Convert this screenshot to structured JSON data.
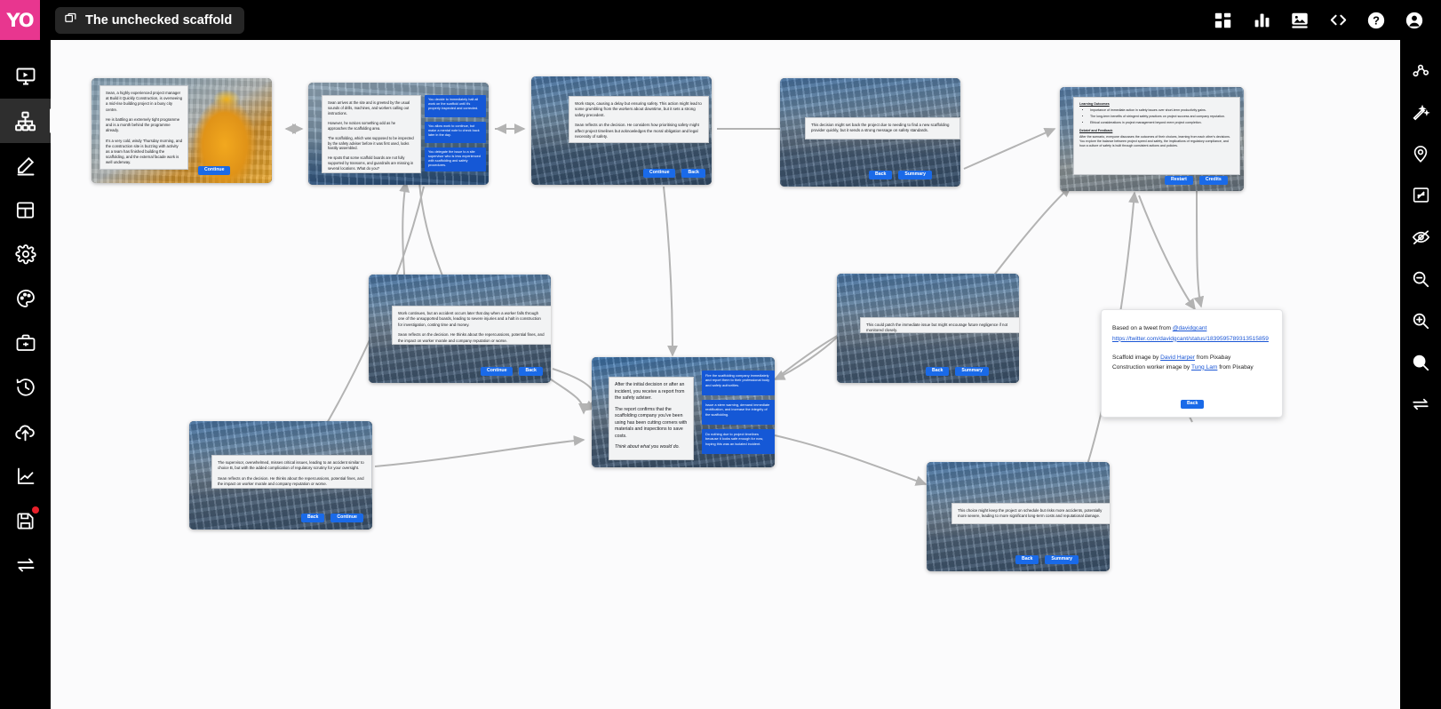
{
  "app": {
    "logo_text": "YO",
    "title": "The unchecked scaffold",
    "title_icon": "copy-windows-icon"
  },
  "topbar": {
    "icons": [
      {
        "name": "dashboard-grid-icon",
        "label": "Dashboard"
      },
      {
        "name": "analytics-bar-chart-icon",
        "label": "Analytics"
      },
      {
        "name": "media-image-icon",
        "label": "Media"
      },
      {
        "name": "code-brackets-icon",
        "label": "Code"
      },
      {
        "name": "help-question-icon",
        "label": "Help"
      },
      {
        "name": "user-account-icon",
        "label": "Account"
      }
    ]
  },
  "left_rail": {
    "items": [
      {
        "name": "preview-play-icon",
        "label": "Preview",
        "active": false
      },
      {
        "name": "flow-tree-icon",
        "label": "Flow",
        "active": true
      },
      {
        "name": "pencil-edit-icon",
        "label": "Edit",
        "active": false
      },
      {
        "name": "layout-template-icon",
        "label": "Layout",
        "active": false
      },
      {
        "name": "settings-gear-icon",
        "label": "Settings",
        "active": false
      },
      {
        "name": "theme-palette-icon",
        "label": "Theme",
        "active": false
      },
      {
        "name": "toolbox-icon",
        "label": "Tools",
        "active": false
      },
      {
        "name": "history-clock-icon",
        "label": "History",
        "active": false
      },
      {
        "name": "cloud-upload-icon",
        "label": "Publish",
        "active": false
      },
      {
        "name": "analytics-line-chart-icon",
        "label": "Stats",
        "active": false
      },
      {
        "name": "save-floppy-icon",
        "label": "Save",
        "active": false,
        "badge": true
      },
      {
        "name": "swap-arrows-icon",
        "label": "Swap",
        "active": false
      }
    ]
  },
  "right_rail": {
    "items": [
      {
        "name": "node-graph-icon",
        "label": "Graph"
      },
      {
        "name": "magic-wand-icon",
        "label": "Auto layout"
      },
      {
        "name": "map-pin-icon",
        "label": "Pin"
      },
      {
        "name": "fit-screen-icon",
        "label": "Fit to screen"
      },
      {
        "name": "eye-hidden-icon",
        "label": "Hide"
      },
      {
        "name": "zoom-out-icon",
        "label": "Zoom out"
      },
      {
        "name": "zoom-in-icon",
        "label": "Zoom in"
      },
      {
        "name": "zoom-reset-icon",
        "label": "Reset zoom"
      },
      {
        "name": "swap-arrows-icon",
        "label": "Swap"
      }
    ]
  },
  "colors": {
    "brand_pink": "#E8368F",
    "choice_blue": "#1558d6",
    "button_blue": "#1a6ae8",
    "canvas_bg": "#fbfbfc",
    "rail_bg": "#000000",
    "badge_red": "#e8202a"
  },
  "nodes": [
    {
      "id": "intro",
      "paragraphs": [
        "Sean, a highly experienced project manager at Build it Quickly Construction, is overseeing a mid-rise building project in a busy city centre.",
        "He is battling an extremely tight programme and is a month behind the programme already.",
        "It's a very cold, windy Thursday morning, and the construction site is buzzing with activity as a team has finished building the scaffolding, and the external facade work is well underway."
      ],
      "buttons": [
        "Continue"
      ]
    },
    {
      "id": "arrival",
      "paragraphs": [
        "Sean arrives at the site and is greeted by the usual sounds of drills, machines, and workers calling out instructions.",
        "However, he notices something odd as he approaches the scaffolding area.",
        "The scaffolding, which was supposed to be inspected by the safety adviser before it was first used, looks hastily assembled.",
        "He spots that some scaffold boards are not fully supported by transoms, and guardrails are missing in several locations.  What do you?"
      ],
      "choices": [
        "You decide to immediately halt all work on the scaffold until it's properly inspected and corrected.",
        "You allow work to continue, but make a mental note to check back later in the day.",
        "You delegate the issue to a site supervisor who is less experienced with scaffolding and safety procedures."
      ],
      "buttons": []
    },
    {
      "id": "work-stops",
      "paragraphs": [
        "Work stops, causing a delay but ensuring safety. This action might lead to some grumbling from the workers about downtime, but it sets a strong safety precedent.",
        "Sean reflects on the decision. He considers how prioritising safety might affect project timelines but acknowledges the moral obligation and legal necessity of safety."
      ],
      "buttons": [
        "Continue",
        "Back"
      ]
    },
    {
      "id": "setback",
      "paragraphs": [
        "This decision might set back the project due to needing to find a new scaffolding provider quickly, but it sends a strong message on safety standards."
      ],
      "buttons": [
        "Back",
        "Summary"
      ]
    },
    {
      "id": "learning-outcomes",
      "heading_1": "Learning Outcomes",
      "bullets": [
        "Importance of immediate action in safety issues over short-term productivity gains.",
        "The long-term benefits of stringent safety practices on project success and company reputation.",
        "Ethical considerations in project management beyond mere project completion."
      ],
      "heading_2": "Debrief and Feedback",
      "paragraphs": [
        "After the scenario, everyone discusses the outcomes of their choices, learning from each other's decisions. You explore the balance between project speed and safety, the implications of regulatory compliance, and how a culture of safety is built through consistent actions and policies."
      ],
      "buttons": [
        "Restart",
        "Credits"
      ]
    },
    {
      "id": "accident",
      "paragraphs": [
        "Work continues, but an accident occurs later that day when a worker falls through one of the unsupported boards, leading to severe injuries and a halt in construction for investigation, costing time and money.",
        "Sean reflects on the decision. He thinks about the repercussions, potential fines, and the impact on worker morale and company reputation or worse."
      ],
      "buttons": [
        "Continue",
        "Back"
      ]
    },
    {
      "id": "supervisor",
      "paragraphs": [
        "The supervisor, overwhelmed, misses critical issues, leading to an accident similar to choice B, but with the added complication of regulatory scrutiny for your oversight.",
        "Sean reflects on the decision. He thinks about the repercussions, potential fines, and the impact on worker morale and company reputation or worse."
      ],
      "buttons": [
        "Back",
        "Continue"
      ]
    },
    {
      "id": "report",
      "paragraphs": [
        "After the initial decision or after an incident, you receive a report from the safety adviser.",
        "The report confirms that the scaffolding company you've been using has been cutting corners with materials and inspections to save costs."
      ],
      "italic_line": "Think about what you would do.",
      "choices": [
        "Fire the scaffolding company immediately and report them to their professional body and safety authorities.",
        "Issue a stern warning, demand immediate rectification, and increase the integrity of the scaffolding.",
        "Do nothing due to project timelines because it looks safe enough for now, hoping this was an isolated incident."
      ],
      "buttons": []
    },
    {
      "id": "patch",
      "paragraphs": [
        "This could patch the immediate issue but might encourage future negligence if not monitored closely."
      ],
      "buttons": [
        "Back",
        "Summary"
      ]
    },
    {
      "id": "schedule-risk",
      "paragraphs": [
        "This choice might keep the project on schedule but risks more accidents, potentially more severe, leading to more significant long-term costs and reputational damage."
      ],
      "buttons": [
        "Back",
        "Summary"
      ]
    }
  ],
  "credits": {
    "line_1_prefix": "Based on a tweet from ",
    "line_1_link": "@davidgcant",
    "line_2_link": "https://twitter.com/davidgcant/status/1839595789313515859",
    "line_3_prefix": "Scaffold image by ",
    "line_3_link": "David Harper",
    "line_3_suffix": " from Pixabay",
    "line_4_prefix": "Construction worker image by ",
    "line_4_link": "Tung Lam",
    "line_4_suffix": " from Pixabay",
    "button": "Back"
  }
}
